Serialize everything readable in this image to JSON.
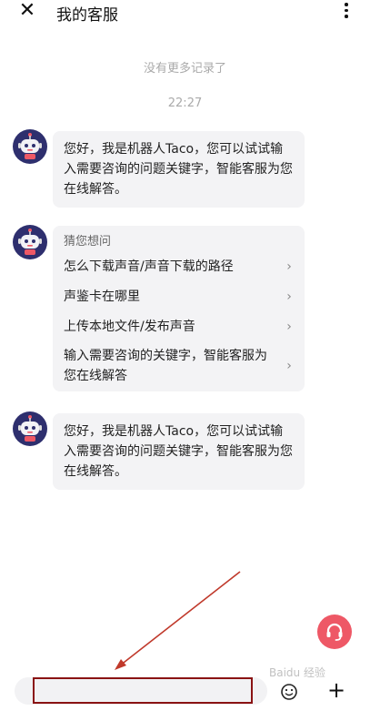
{
  "header": {
    "title": "我的客服",
    "close_icon": "close-icon",
    "more_icon": "more-vertical-icon"
  },
  "chat": {
    "no_more_records": "没有更多记录了",
    "time": "22:27",
    "messages": [
      {
        "type": "text",
        "text": "您好，我是机器人Taco，您可以试试输入需要咨询的问题关键字，智能客服为您在线解答。"
      },
      {
        "type": "guess",
        "title": "猜您想问",
        "items": [
          "怎么下载声音/声音下载的路径",
          "声鉴卡在哪里",
          "上传本地文件/发布声音",
          "输入需要咨询的关键字，智能客服为您在线解答"
        ]
      },
      {
        "type": "text",
        "text": "您好，我是机器人Taco，您可以试试输入需要咨询的问题关键字，智能客服为您在线解答。"
      }
    ]
  },
  "fab": {
    "icon": "headset-icon",
    "color": "#ee5866"
  },
  "input": {
    "value": "",
    "placeholder": ""
  },
  "toolbar": {
    "emoji_icon": "emoji-icon",
    "plus_label": "+"
  },
  "watermark": {
    "text": "Baidu 经验"
  },
  "colors": {
    "accent": "#ee5866",
    "annotation": "#c0392b",
    "highlight": "#8a1313"
  }
}
